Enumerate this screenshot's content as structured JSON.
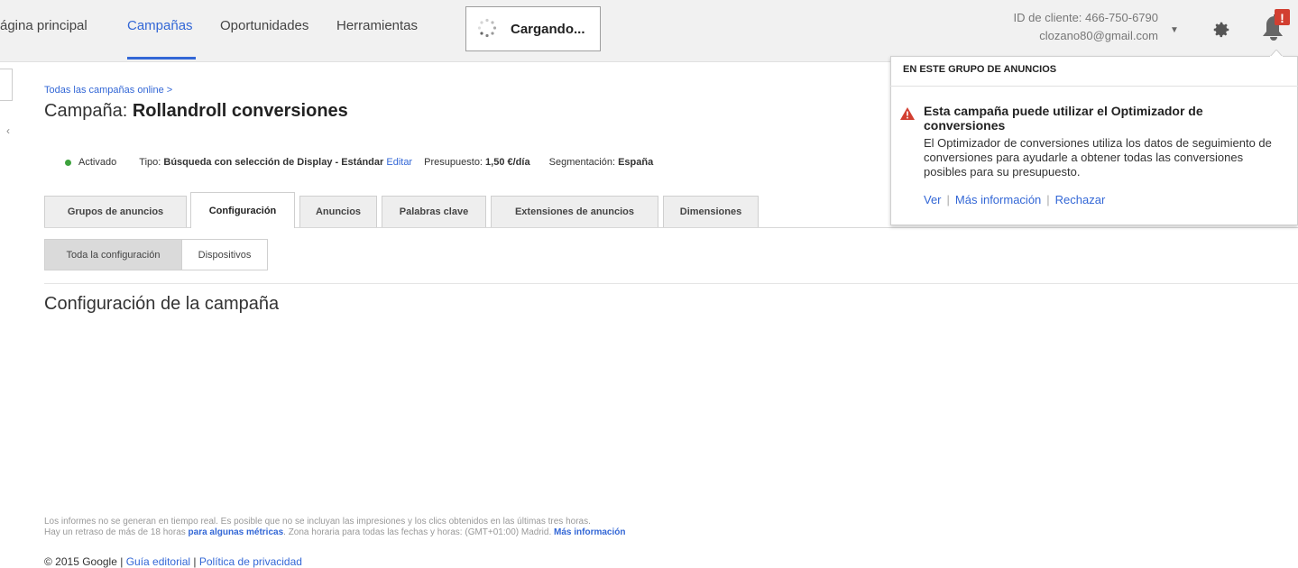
{
  "nav": {
    "items": [
      {
        "label": "ágina principal"
      },
      {
        "label": "Campañas"
      },
      {
        "label": "Oportunidades"
      },
      {
        "label": "Herramientas"
      }
    ],
    "loading_text": "Cargando...",
    "client_id": "ID de cliente: 466-750-6790",
    "email": "clozano80@gmail.com",
    "notification_badge": "!"
  },
  "breadcrumb": "Todas las campañas online >",
  "campaign": {
    "title_prefix": "Campaña: ",
    "title_name": "Rollandroll conversiones"
  },
  "status": {
    "state": "Activado",
    "type_label": "Tipo: ",
    "type_value": "Búsqueda con selección de Display - Estándar",
    "edit": "Editar",
    "budget_label": "Presupuesto: ",
    "budget_value": "1,50 €/día",
    "segment_label": "Segmentación: ",
    "segment_value": "España"
  },
  "tabs": [
    {
      "label": "Grupos de anuncios"
    },
    {
      "label": "Configuración"
    },
    {
      "label": "Anuncios"
    },
    {
      "label": "Palabras clave"
    },
    {
      "label": "Extensiones de anuncios"
    },
    {
      "label": "Dimensiones"
    }
  ],
  "subtabs": [
    {
      "label": "Toda la configuración"
    },
    {
      "label": "Dispositivos"
    }
  ],
  "section_title": "Configuración de la campaña",
  "footer": {
    "line1": "Los informes no se generan en tiempo real. Es posible que no se incluyan las impresiones y los clics obtenidos en las últimas tres horas.",
    "line2_a": "Hay un retraso de más de 18 horas ",
    "line2_link": "para algunas métricas",
    "line2_b": ". Zona horaria para todas las fechas y horas: (GMT+01:00) Madrid. ",
    "line2_link2": "Más información",
    "copyright": "© 2015 Google",
    "sep": " | ",
    "link1": "Guía editorial",
    "link2": "Política de privacidad"
  },
  "popup": {
    "header": "EN ESTE GRUPO DE ANUNCIOS",
    "title": "Esta campaña puede utilizar el Optimizador de conversiones",
    "body": "El Optimizador de conversiones utiliza los datos de seguimiento de conversiones para ayudarle a obtener todas las conversiones posibles para su presupuesto.",
    "link_view": "Ver",
    "link_more": "Más información",
    "link_reject": "Rechazar",
    "sep": "|"
  },
  "colors": {
    "accent": "#3367d6",
    "active_dot": "#3da23d",
    "warning": "#d23f31"
  }
}
